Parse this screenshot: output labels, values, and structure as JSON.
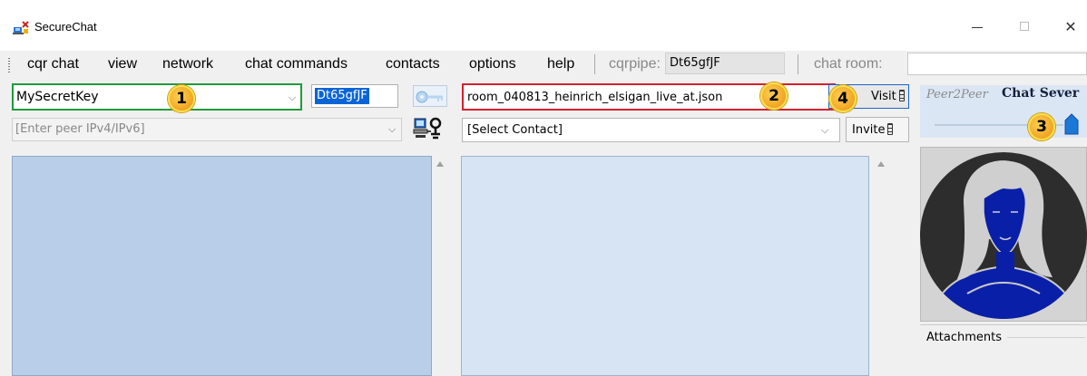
{
  "window": {
    "title": "SecureChat"
  },
  "menu": {
    "items": [
      "cqr chat",
      "view",
      "network",
      "chat commands",
      "contacts",
      "options",
      "help"
    ],
    "cqrpipe_label": "cqrpipe:",
    "cqrpipe_value": "Dt65gfJF",
    "chatroom_label": "chat room:",
    "chatroom_value": ""
  },
  "controls": {
    "secret_key": "MySecretKey",
    "pipe_value": "Dt65gfJF",
    "room_file": "room_040813_heinrich_elsigan_live_at.json",
    "visit_label": "Visit",
    "peer_placeholder": "[Enter peer IPv4/IPv6]",
    "contact_select": "[Select Contact]",
    "invite_label": "Invite"
  },
  "right_panel": {
    "tab_peer": "Peer2Peer",
    "tab_server": "Chat Sever",
    "attachments_label": "Attachments"
  },
  "callouts": [
    "1",
    "2",
    "3",
    "4"
  ],
  "colors": {
    "secret_key_border": "#1f9b3a",
    "room_border": "#d6202c",
    "callout_fill": "#f0a020",
    "panel_blue": "#b9cfe9",
    "avatar_blue": "#0a1fa8"
  }
}
